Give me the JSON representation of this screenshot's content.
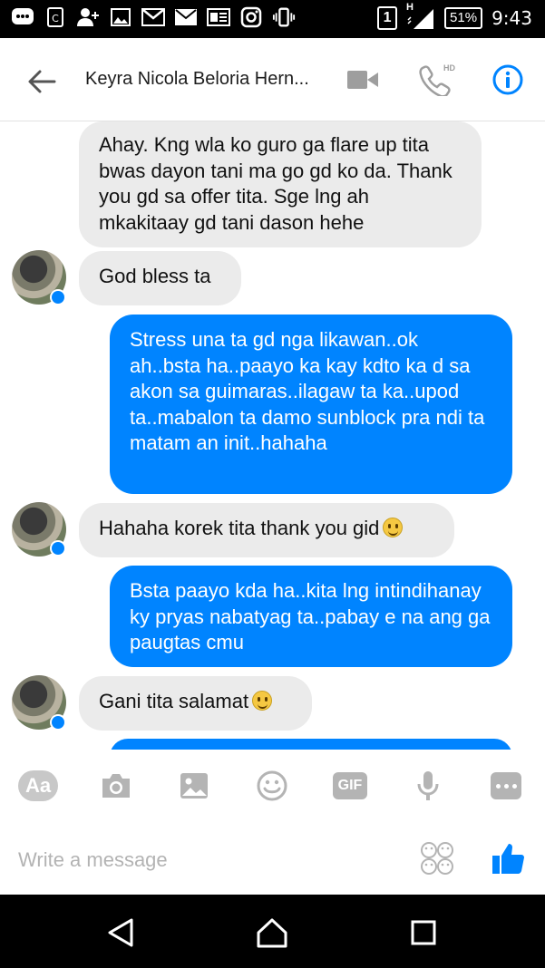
{
  "status_bar": {
    "battery": "51%",
    "time": "9:43",
    "sim_slot": "1",
    "network": "H",
    "left_icons": [
      "messenger-chat-icon",
      "clipboard-icon",
      "add-contact-icon",
      "gallery-icon",
      "gmail-icon",
      "email-icon",
      "news-icon",
      "instagram-icon",
      "vibrate-icon"
    ]
  },
  "header": {
    "title": "Keyra Nicola Beloria Hern...",
    "icons": [
      "back-arrow-icon",
      "video-call-icon",
      "hd-call-icon",
      "info-icon"
    ],
    "hd_label": "HD"
  },
  "messages": [
    {
      "dir": "in",
      "text": "Ahay. Kng wla ko guro ga flare up tita bwas dayon tani ma go gd ko da. Thank you gd sa offer tita. Sge lng ah mkakitaay gd tani dason hehe",
      "avatar": false
    },
    {
      "dir": "in",
      "text": "God bless ta",
      "avatar": true
    },
    {
      "dir": "out",
      "text": "Stress una ta gd nga likawan..ok ah..bsta ha..paayo ka kay kdto ka d sa akon sa guimaras..ilagaw ta ka..upod ta..mabalon ta damo sunblock pra ndi ta matam an init..hahaha"
    },
    {
      "dir": "in",
      "text": "Hahaha korek tita thank you gid",
      "emoji": "smiley-emoji",
      "avatar": true
    },
    {
      "dir": "out",
      "text": "Bsta paayo kda ha..kita lng intindihanay ky pryas nabatyag ta..pabay e na ang ga paugtas cmu"
    },
    {
      "dir": "in",
      "text": "Gani tita salamat",
      "emoji": "smiley-emoji",
      "avatar": true
    }
  ],
  "toolbar": {
    "text_button_label": "Aa",
    "gif_label": "GIF",
    "icons": [
      "camera-icon",
      "image-icon",
      "emoji-icon",
      "microphone-icon",
      "more-icon"
    ]
  },
  "composer": {
    "placeholder": "Write a message"
  },
  "colors": {
    "accent": "#0084ff",
    "incoming_bubble": "#ebebeb"
  }
}
